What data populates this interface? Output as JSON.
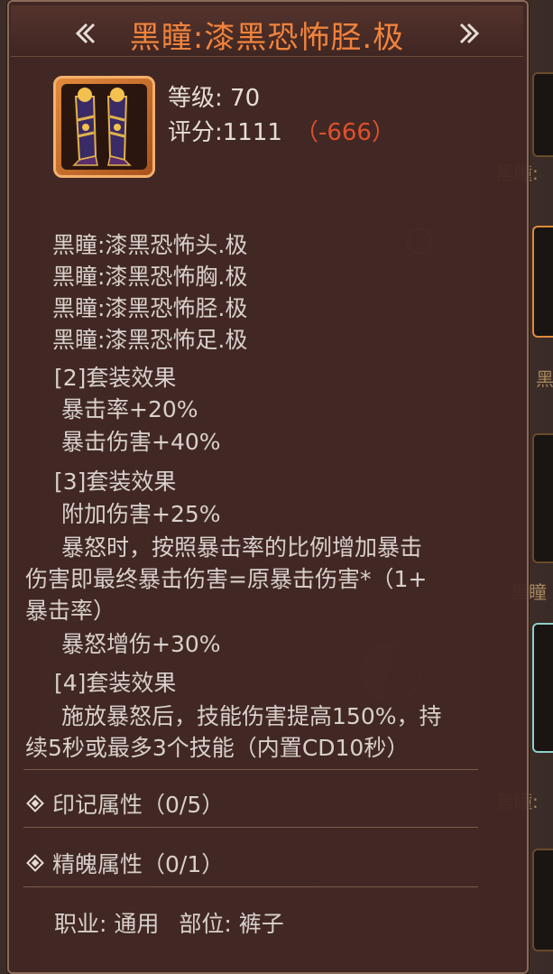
{
  "panel": {
    "title": "黑瞳:漆黑恐怖胫.极",
    "level_label": "等级: 70",
    "score_label": "评分:",
    "score_value": "1111",
    "score_diff": "（-666）"
  },
  "set_pieces": [
    "黑瞳:漆黑恐怖头.极",
    "黑瞳:漆黑恐怖胸.极",
    "黑瞳:漆黑恐怖胫.极",
    "黑瞳:漆黑恐怖足.极"
  ],
  "set_effects": {
    "two_title": "[2]套装效果",
    "two_line1": "暴击率+20%",
    "two_line2": "暴击伤害+40%",
    "three_title": "[3]套装效果",
    "three_line1": "附加伤害+25%",
    "three_line2": "暴怒时，按照暴击率的比例增加暴击",
    "three_line3": "伤害即最终暴击伤害=原暴击伤害*（1+",
    "three_line4": "暴击率）",
    "three_line5": "暴怒增伤+30%",
    "four_title": "[4]套装效果",
    "four_line1": "施放暴怒后，技能伤害提高150%，持",
    "four_line2": "续5秒或最多3个技能（内置CD10秒）"
  },
  "attributes": {
    "mark_label": "印记属性（0/5）",
    "soul_label": "精魄属性（0/1）"
  },
  "footer": {
    "class_label": "职业: 通用",
    "slot_label": "部位: 裤子"
  },
  "background": {
    "side_label_1": "黑瞳:",
    "side_label_2": "黑",
    "side_label_3": "黑瞳",
    "side_label_4": "黑瞳:"
  },
  "icons": {
    "item": "golden-leg-armor-icon",
    "title_left": "double-chevron-left-icon",
    "title_right": "double-chevron-right-icon"
  },
  "colors": {
    "title": "#f0833c",
    "negative": "#e0502c",
    "text": "#d8d0cc"
  }
}
